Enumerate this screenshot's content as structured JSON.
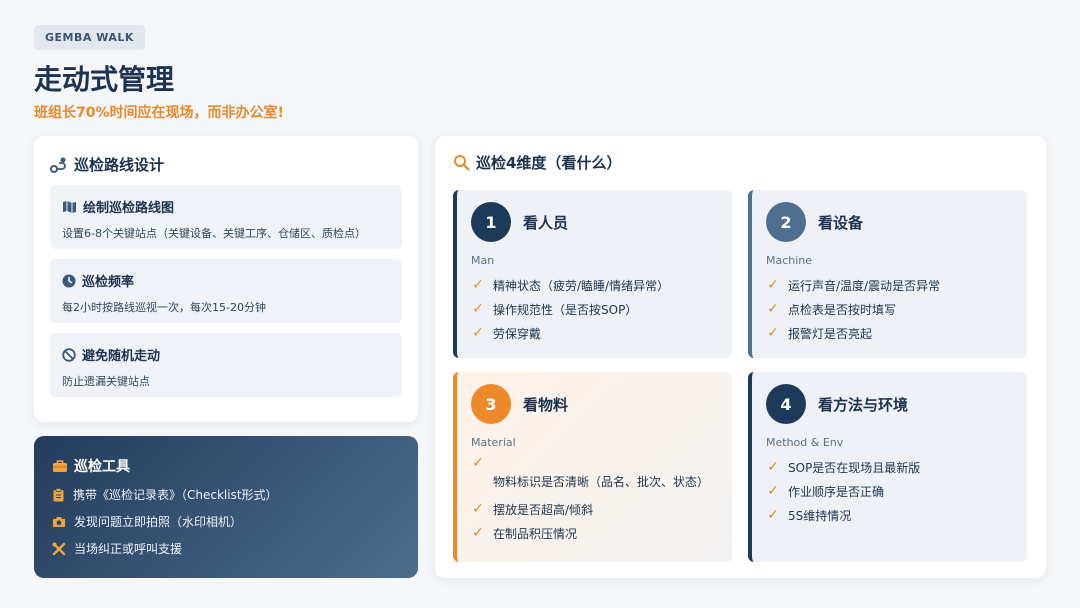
{
  "header": {
    "tag": "GEMBA WALK",
    "title": "走动式管理",
    "subtitle": "班组长70%时间应在现场，而非办公室!"
  },
  "route": {
    "title": "巡检路线设计",
    "items": [
      {
        "icon": "map-icon",
        "title": "绘制巡检路线图",
        "desc": "设置6-8个关键站点（关键设备、关键工序、仓储区、质检点）"
      },
      {
        "icon": "clock-icon",
        "title": "巡检频率",
        "desc": "每2小时按路线巡视一次，每次15-20分钟"
      },
      {
        "icon": "ban-icon",
        "title": "避免随机走动",
        "desc": "防止遗漏关键站点"
      }
    ]
  },
  "tools": {
    "title": "巡检工具",
    "items": [
      {
        "icon": "clipboard-icon",
        "text": "携带《巡检记录表》（Checklist形式）"
      },
      {
        "icon": "camera-icon",
        "text": "发现问题立即拍照（水印相机）"
      },
      {
        "icon": "tools-icon",
        "text": "当场纠正或呼叫支援"
      }
    ]
  },
  "dimensions": {
    "title": "巡检4维度（看什么）",
    "items": [
      {
        "num": "1",
        "title": "看人员",
        "en": "Man",
        "checks": [
          "精神状态（疲劳/瞌睡/情绪异常）",
          "操作规范性（是否按SOP）",
          "劳保穿戴"
        ]
      },
      {
        "num": "2",
        "title": "看设备",
        "en": "Machine",
        "checks": [
          "运行声音/温度/震动是否异常",
          "点检表是否按时填写",
          "报警灯是否亮起"
        ]
      },
      {
        "num": "3",
        "title": "看物料",
        "en": "Material",
        "checks": [
          "物料标识是否清晰（品名、批次、状态）",
          "摆放是否超高/倾斜",
          "在制品积压情况"
        ]
      },
      {
        "num": "4",
        "title": "看方法与环境",
        "en": "Method & Env",
        "checks": [
          "SOP是否在现场且最新版",
          "作业顺序是否正确",
          "5S维持情况"
        ]
      }
    ]
  },
  "colors": {
    "navy": "#1e3a5a",
    "slate": "#4f6f91",
    "accent": "#e8892b"
  }
}
